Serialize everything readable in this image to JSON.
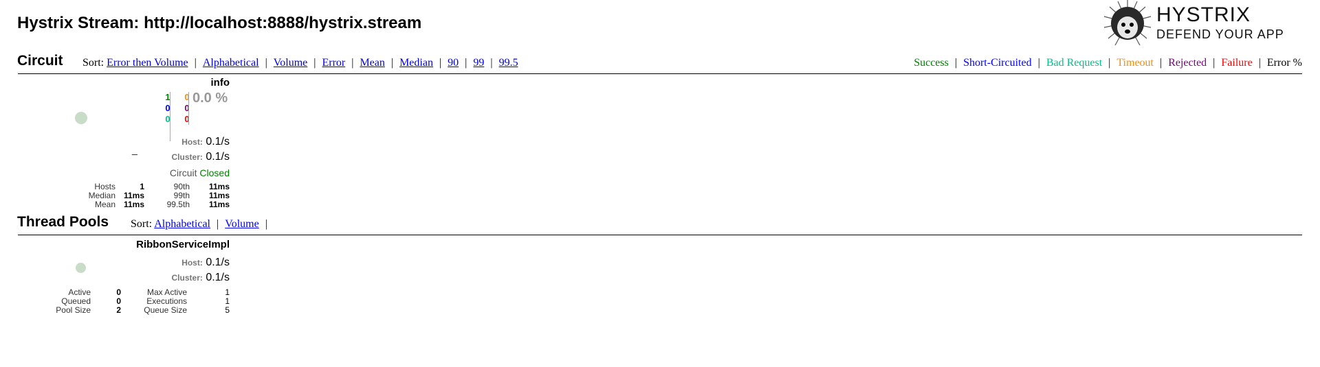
{
  "header": {
    "title": "Hystrix Stream: http://localhost:8888/hystrix.stream",
    "logo": {
      "name": "HYSTRIX",
      "tagline": "DEFEND YOUR APP"
    }
  },
  "circuit": {
    "section_title": "Circuit",
    "sort_label": "Sort:",
    "sort_links": [
      "Error then Volume",
      "Alphabetical",
      "Volume",
      "Error",
      "Mean",
      "Median",
      "90",
      "99",
      "99.5"
    ],
    "legend": [
      {
        "label": "Success",
        "color": "#008000"
      },
      {
        "label": "Short-Circuited",
        "color": "#0000ff"
      },
      {
        "label": "Bad Request",
        "color": "#00c08b"
      },
      {
        "label": "Timeout",
        "color": "#ff8c00"
      },
      {
        "label": "Rejected",
        "color": "#800080"
      },
      {
        "label": "Failure",
        "color": "#ff0000"
      },
      {
        "label": "Error %",
        "color": "#000000"
      }
    ],
    "card": {
      "name": "info",
      "counts_left": [
        "1",
        "0",
        "0"
      ],
      "counts_right": [
        "0",
        "0",
        "0"
      ],
      "error_pct": "0.0 %",
      "sparkline": "_",
      "host_label": "Host:",
      "host_rate": "0.1/s",
      "cluster_label": "Cluster:",
      "cluster_rate": "0.1/s",
      "circuit_label": "Circuit",
      "circuit_status": "Closed",
      "stats": [
        [
          "Hosts",
          "1",
          "90th",
          "11ms"
        ],
        [
          "Median",
          "11ms",
          "99th",
          "11ms"
        ],
        [
          "Mean",
          "11ms",
          "99.5th",
          "11ms"
        ]
      ]
    }
  },
  "thread_pools": {
    "section_title": "Thread Pools",
    "sort_label": "Sort:",
    "sort_links": [
      "Alphabetical",
      "Volume"
    ],
    "trailing_sep": "|",
    "card": {
      "name": "RibbonServiceImpl",
      "host_label": "Host:",
      "host_rate": "0.1/s",
      "cluster_label": "Cluster:",
      "cluster_rate": "0.1/s",
      "stats": [
        [
          "Active",
          "0",
          "Max Active",
          "1"
        ],
        [
          "Queued",
          "0",
          "Executions",
          "1"
        ],
        [
          "Pool Size",
          "2",
          "Queue Size",
          "5"
        ]
      ]
    }
  },
  "colors": {
    "success": "#008000",
    "short": "#0000ff",
    "bad": "#00c08b",
    "timeout": "#ff8c00",
    "rejected": "#800080",
    "failure": "#ff0000",
    "indicator": "#c8dcc8"
  }
}
